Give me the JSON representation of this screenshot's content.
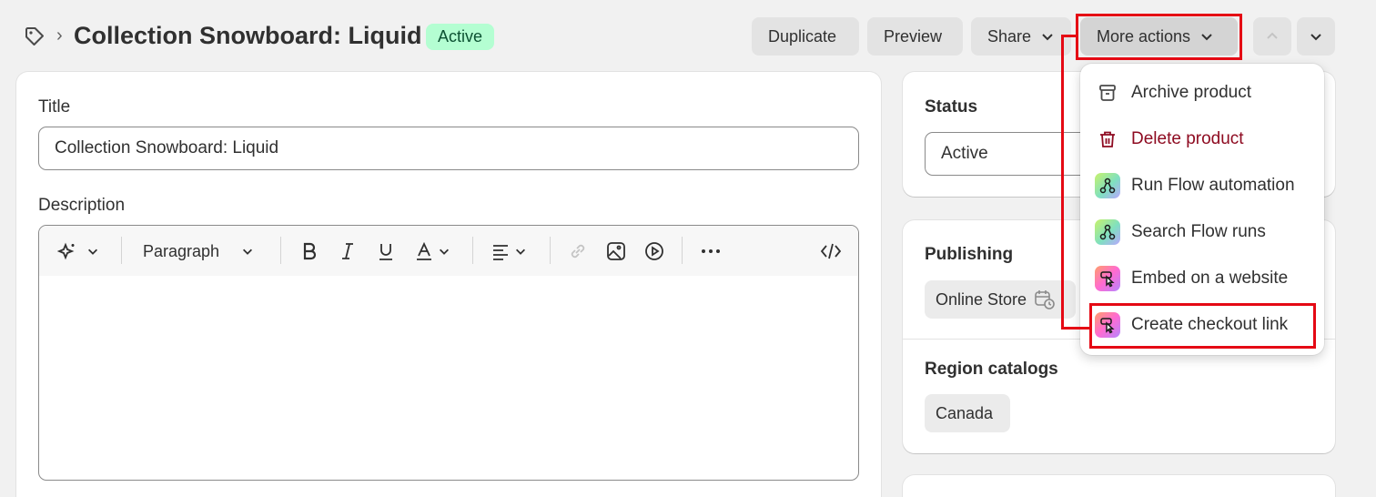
{
  "header": {
    "title": "Collection Snowboard: Liquid",
    "status_badge": "Active",
    "breadcrumb_separator": "›",
    "buttons": {
      "duplicate": "Duplicate",
      "preview": "Preview",
      "share": "Share",
      "more_actions": "More actions"
    }
  },
  "form": {
    "title_label": "Title",
    "title_value": "Collection Snowboard: Liquid",
    "description_label": "Description",
    "editor": {
      "paragraph_label": "Paragraph"
    }
  },
  "status_card": {
    "heading": "Status",
    "selected": "Active"
  },
  "publishing_card": {
    "heading": "Publishing",
    "channel": "Online Store",
    "region_heading": "Region catalogs",
    "region": "Canada"
  },
  "more_actions_menu": {
    "items": [
      {
        "label": "Archive product",
        "icon": "archive-icon"
      },
      {
        "label": "Delete product",
        "icon": "trash-icon"
      },
      {
        "label": "Run Flow automation",
        "icon": "flow-icon"
      },
      {
        "label": "Search Flow runs",
        "icon": "flow-icon"
      },
      {
        "label": "Embed on a website",
        "icon": "buy-button-icon"
      },
      {
        "label": "Create checkout link",
        "icon": "buy-button-icon"
      }
    ]
  },
  "colors": {
    "highlight": "#e50914",
    "badge_bg": "#b4fed2",
    "badge_text": "#0c5132",
    "danger_text": "#8e0b21"
  }
}
